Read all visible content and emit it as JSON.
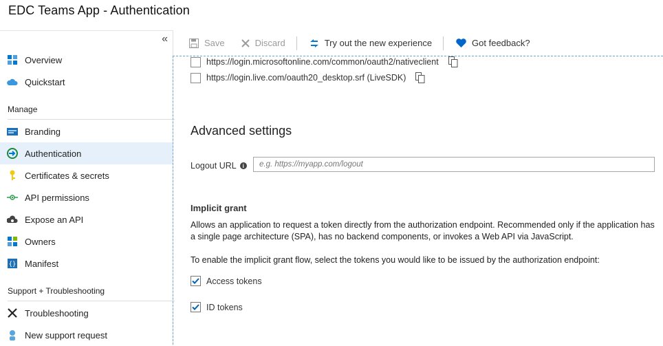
{
  "window": {
    "title": "EDC Teams App - Authentication"
  },
  "sidebar": {
    "collapse_glyph": "«",
    "items_top": [
      {
        "label": "Overview",
        "icon": "overview-icon"
      },
      {
        "label": "Quickstart",
        "icon": "cloud-icon"
      }
    ],
    "manage_label": "Manage",
    "manage_items": [
      {
        "label": "Branding",
        "icon": "branding-icon"
      },
      {
        "label": "Authentication",
        "icon": "authentication-icon",
        "active": true
      },
      {
        "label": "Certificates & secrets",
        "icon": "key-icon"
      },
      {
        "label": "API permissions",
        "icon": "api-permissions-icon"
      },
      {
        "label": "Expose an API",
        "icon": "cloud-gear-icon"
      },
      {
        "label": "Owners",
        "icon": "owners-icon"
      },
      {
        "label": "Manifest",
        "icon": "manifest-icon"
      }
    ],
    "support_label": "Support + Troubleshooting",
    "support_items": [
      {
        "label": "Troubleshooting",
        "icon": "wrench-icon"
      },
      {
        "label": "New support request",
        "icon": "support-person-icon"
      }
    ]
  },
  "toolbar": {
    "save_label": "Save",
    "discard_label": "Discard",
    "try_label": "Try out the new experience",
    "feedback_label": "Got feedback?"
  },
  "redirect_uris": [
    {
      "url": "https://login.microsoftonline.com/common/oauth2/nativeclient",
      "checked": false
    },
    {
      "url": "https://login.live.com/oauth20_desktop.srf (LiveSDK)",
      "checked": false
    }
  ],
  "advanced": {
    "heading": "Advanced settings",
    "logout_label": "Logout URL",
    "logout_placeholder": "e.g. https://myapp.com/logout",
    "logout_value": ""
  },
  "implicit": {
    "title": "Implicit grant",
    "description": "Allows an application to request a token directly from the authorization endpoint. Recommended only if the application has a single page architecture (SPA), has no backend components, or invokes a Web API via JavaScript.",
    "prompt": "To enable the implicit grant flow, select the tokens you would like to be issued by the authorization endpoint:",
    "tokens": [
      {
        "label": "Access tokens",
        "checked": true
      },
      {
        "label": "ID tokens",
        "checked": true
      }
    ]
  },
  "colors": {
    "accent": "#0078d4",
    "active_bg": "#e6f0fa",
    "check": "#0063b1"
  }
}
